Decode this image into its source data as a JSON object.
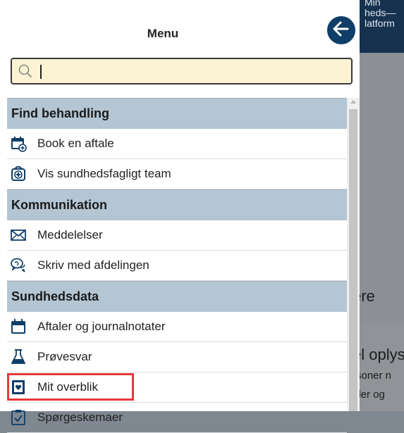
{
  "background": {
    "logo_line1": "Min",
    "logo_line2": "heds—",
    "logo_line3": "latform",
    "text_1": "ere",
    "text_2": "el oplys",
    "text_3": "rsoner n",
    "text_4": "aler og"
  },
  "menu": {
    "title": "Menu",
    "search_placeholder": ""
  },
  "sections": [
    {
      "title": "Find behandling",
      "items": [
        {
          "label": "Book en aftale",
          "icon": "calendar-plus-icon"
        },
        {
          "label": "Vis sundhedsfagligt team",
          "icon": "medical-team-icon"
        }
      ]
    },
    {
      "title": "Kommunikation",
      "items": [
        {
          "label": "Meddelelser",
          "icon": "envelope-icon"
        },
        {
          "label": "Skriv med afdelingen",
          "icon": "chat-bubbles-icon"
        }
      ]
    },
    {
      "title": "Sundhedsdata",
      "items": [
        {
          "label": "Aftaler og journalnotater",
          "icon": "calendar-icon"
        },
        {
          "label": "Prøvesvar",
          "icon": "flask-icon"
        },
        {
          "label": "Mit overblik",
          "icon": "overview-icon"
        },
        {
          "label": "Spørgeskemaer",
          "icon": "checklist-icon"
        }
      ]
    }
  ],
  "colors": {
    "accent": "#0f3e69",
    "section_bg": "#b4c5d3",
    "highlight": "#e5383b",
    "search_bg": "#fbf3d2"
  }
}
